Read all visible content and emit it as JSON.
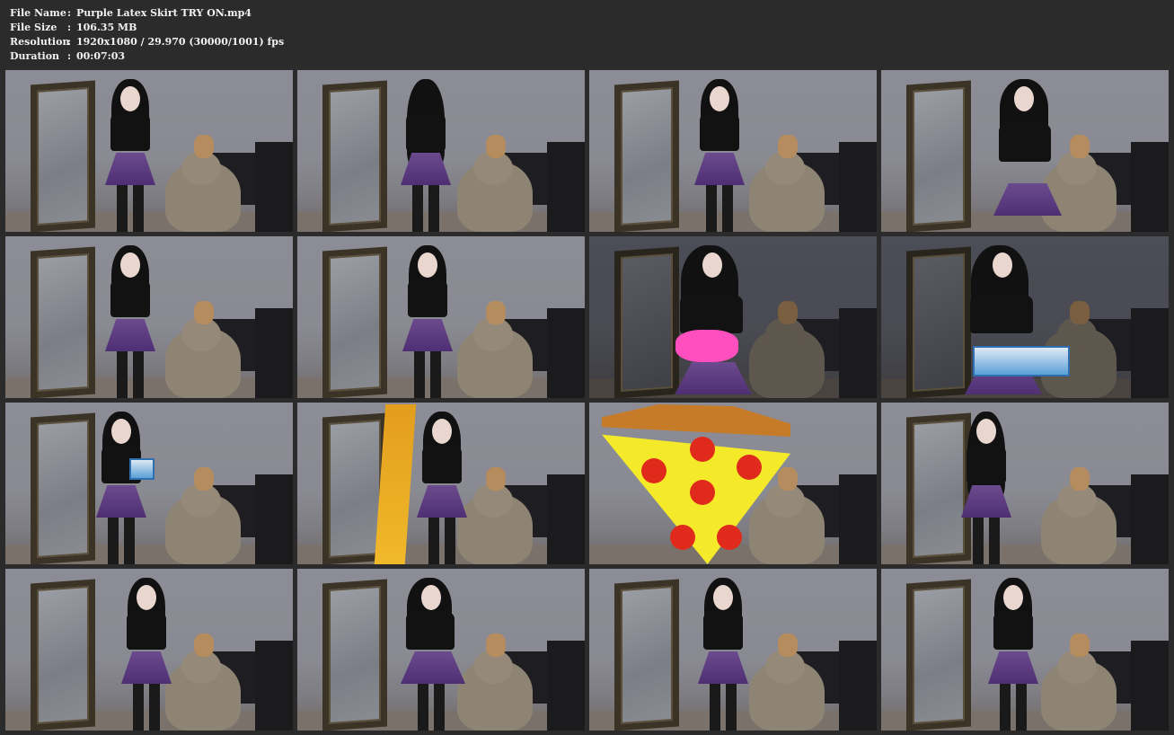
{
  "header": {
    "file_name": {
      "label": "File Name",
      "sep": ":",
      "value": "Purple Latex Skirt TRY ON.mp4"
    },
    "file_size": {
      "label": "File Size",
      "sep": ":",
      "value": "106.35 MB"
    },
    "resolution": {
      "label": "Resolution",
      "sep": ":",
      "value": "1920x1080 / 29.970 (30000/1001) fps"
    },
    "duration": {
      "label": "Duration",
      "sep": ":",
      "value": "00:07:03"
    }
  },
  "thumbnails": [
    {
      "scene": "pose-arms-out"
    },
    {
      "scene": "back-view"
    },
    {
      "scene": "side-profile"
    },
    {
      "scene": "close-front"
    },
    {
      "scene": "front-standing"
    },
    {
      "scene": "turning"
    },
    {
      "scene": "pink-item",
      "dark": true
    },
    {
      "scene": "holding-box",
      "dark": true
    },
    {
      "scene": "holding-box-side"
    },
    {
      "scene": "inflatable-pizza"
    },
    {
      "scene": "pizza-closeup"
    },
    {
      "scene": "adjusting-hair"
    },
    {
      "scene": "dancing"
    },
    {
      "scene": "arms-wide"
    },
    {
      "scene": "hands-up"
    },
    {
      "scene": "walking-forward"
    }
  ]
}
